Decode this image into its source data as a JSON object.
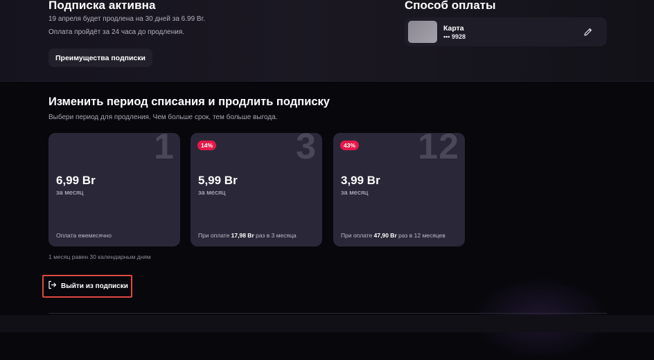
{
  "subscription": {
    "title": "Подписка активна",
    "renewal_text": "19 апреля будет продлена на 30 дней за 6.99 Br.",
    "payment_notice": "Оплата пройдёт за 24 часа до продления.",
    "benefits_button": "Преимущества подписки"
  },
  "payment": {
    "title": "Способ оплаты",
    "card_name": "Карта",
    "card_number": "••• 9928",
    "edit_icon": "pencil-icon"
  },
  "change_period": {
    "title": "Изменить период списания и продлить подписку",
    "subtitle": "Выбери период для продления. Чем больше срок, тем больше выгода."
  },
  "plans": [
    {
      "months": "1",
      "badge": "",
      "price": "6,99 Br",
      "per": "за месяц",
      "note_prefix": "Оплата ежемесячно",
      "note_amount": "",
      "note_suffix": ""
    },
    {
      "months": "3",
      "badge": "14%",
      "price": "5,99 Br",
      "per": "за месяц",
      "note_prefix": "При оплате ",
      "note_amount": "17,98 Br",
      "note_suffix": " раз в 3 месяца"
    },
    {
      "months": "12",
      "badge": "43%",
      "price": "3,99 Br",
      "per": "за месяц",
      "note_prefix": "При оплате ",
      "note_amount": "47,90 Br",
      "note_suffix": " раз в 12 месяцев"
    }
  ],
  "footnote": "1 месяц равен 30 календарным дням",
  "exit": {
    "label": "Выйти из подписки",
    "icon": "exit-icon"
  },
  "colors": {
    "background": "#08070c",
    "card": "#2a2838",
    "badge": "#e5194a",
    "highlight_border": "#e0483f"
  }
}
